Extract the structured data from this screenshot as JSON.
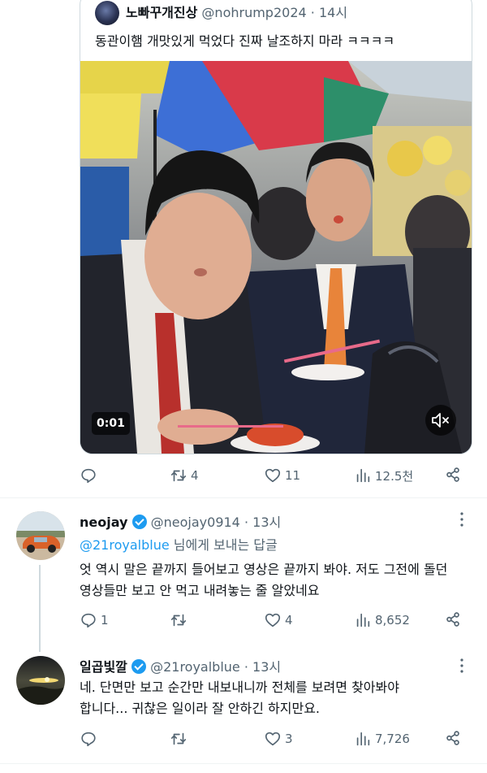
{
  "quoted_tweet": {
    "author_name": "노빠꾸개진상",
    "handle": "@nohrump2024",
    "time": "14시",
    "text": "동관이햄 개맛있게 먹었다 진짜 날조하지 마라 ㅋㅋㅋㅋ",
    "video": {
      "duration": "0:01",
      "mute_icon": "speaker-muted-icon"
    },
    "stats": {
      "replies": "",
      "retweets": "4",
      "likes": "11",
      "views": "12.5천"
    }
  },
  "reply1": {
    "author_name": "neojay",
    "handle": "@neojay0914",
    "time": "13시",
    "replying_to": "@21royalblue",
    "replying_suffix": "님에게 보내는 답글",
    "text_line1": "엇 역시 말은 끝까지 들어보고 영상은 끝까지 봐야. 저도 그전에 돌던",
    "text_line2": "영상들만 보고 안 먹고 내려놓는 줄 알았네요",
    "stats": {
      "replies": "1",
      "retweets": "",
      "likes": "4",
      "views": "8,652"
    }
  },
  "reply2": {
    "author_name": "일곱빛깔",
    "handle": "@21royalblue",
    "time": "13시",
    "text_line1": "네. 단면만 보고 순간만 내보내니까 전체를 보려면 찾아봐야",
    "text_line2": "합니다... 귀찮은 일이라 잘 안하긴 하지만요.",
    "stats": {
      "replies": "",
      "retweets": "",
      "likes": "3",
      "views": "7,726"
    }
  },
  "colors": {
    "accent": "#1d9bf0",
    "text": "#0f1419",
    "muted": "#536471",
    "divider": "#eff3f4"
  }
}
